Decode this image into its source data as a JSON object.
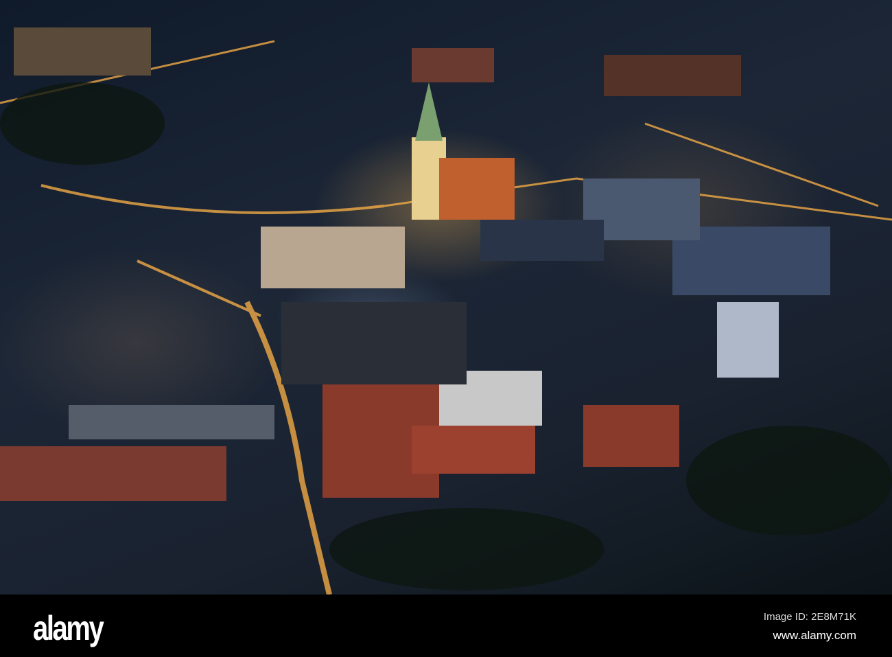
{
  "photo": {
    "subject": "night aerial city view"
  },
  "footer": {
    "logo": "alamy",
    "image_id": "Image ID: 2E8M71K",
    "url": "www.alamy.com"
  },
  "colors": {
    "street_light": "#ffb347",
    "roof": "#8a3a2a",
    "night": "#152030"
  }
}
